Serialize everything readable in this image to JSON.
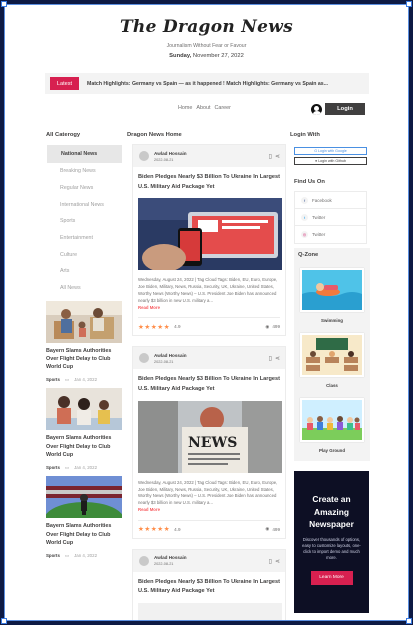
{
  "masthead": {
    "logo": "The Dragon News",
    "tagline": "Journalism Without Fear or Favour",
    "day": "Sunday,",
    "date": "November 27, 2022"
  },
  "ticker": {
    "label": "Latest",
    "text": "Match Highlights: Germany vs Spain — as it happened  !  Match Highlights: Germany vs Spain as..."
  },
  "nav": {
    "links": [
      "Home",
      "About",
      "Career"
    ],
    "login_label": "Login"
  },
  "left": {
    "title": "All Caterogy",
    "active_category": "National News",
    "categories": [
      "Breaking News",
      "Regular News",
      "International News",
      "Sports",
      "Entertainment",
      "Culture",
      "Arts",
      "All News"
    ],
    "side_news": [
      {
        "title": "Bayern Slams Authorities Over Flight Delay to Club World Cup",
        "tag": "Sports",
        "date": "Jan 4, 2022"
      },
      {
        "title": "Bayern Slams Authorities Over Flight Delay to Club World Cup",
        "tag": "Sports",
        "date": "Jan 4, 2022"
      },
      {
        "title": "Bayern Slams Authorities Over Flight Delay to Club World Cup",
        "tag": "Sports",
        "date": "Jan 4, 2022"
      }
    ]
  },
  "center": {
    "title": "Dragon News Home",
    "cards": [
      {
        "author": "Awlad Hossain",
        "date": "2022-08-21",
        "title": "Biden Pledges Nearly $3 Billion To Ukraine In Largest U.S. Military Aid Package Yet",
        "text": "Wednesday, August 24, 2022 | Tag Cloud Tags: Biden, EU, Euro, Europe, Joe Biden, Military, News, Russia, Security, UK, Ukraine, United States, Worthy News (Worthy News) – U.S. President Joe Biden has announced nearly $3 billion in new U.S. military a...",
        "read_more": "Read More",
        "rating": "4.9",
        "views": "499"
      },
      {
        "author": "Awlad Hossain",
        "date": "2022-08-21",
        "title": "Biden Pledges Nearly $3 Billion To Ukraine In Largest U.S. Military Aid Package Yet",
        "text": "Wednesday, August 24, 2022 | Tag Cloud Tags: Biden, EU, Euro, Europe, Joe Biden, Military, News, Russia, Security, UK, Ukraine, United States, Worthy News (Worthy News) – U.S. President Joe Biden has announced nearly $3 billion in new U.S. military a...",
        "read_more": "Read More",
        "rating": "4.9",
        "views": "499"
      },
      {
        "author": "Awlad Hossain",
        "date": "2022-08-21",
        "title": "Biden Pledges Nearly $3 Billion To Ukraine In Largest U.S. Military Aid Package Yet"
      }
    ]
  },
  "right": {
    "login_title": "Login With",
    "google": "Login with Google",
    "github": "Login with Github",
    "find_title": "Find Us On",
    "social": [
      "Facebook",
      "Twitter",
      "Twitter"
    ],
    "qzone_title": "Q-Zone",
    "qzone": [
      "Swimming",
      "Class",
      "Play Ground"
    ],
    "ad": {
      "headline": "Create an Amazing Newspaper",
      "body": "Discover thousands of options, easy to customize layouts, one-click to import demo and much more.",
      "button": "Learn More"
    }
  }
}
